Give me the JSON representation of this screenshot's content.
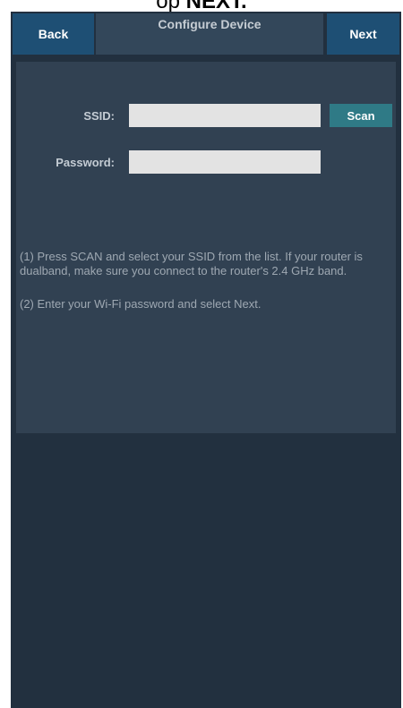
{
  "caption": {
    "prefix": "op ",
    "emphasis": "NEXT."
  },
  "header": {
    "back_label": "Back",
    "title": "Configure Device",
    "next_label": "Next"
  },
  "form": {
    "ssid_label": "SSID:",
    "ssid_value": "",
    "scan_label": "Scan",
    "password_label": "Password:",
    "password_value": ""
  },
  "instructions": {
    "step1": "(1) Press SCAN and select your SSID from the list. If your router is dualband, make sure you connect to the router's 2.4 GHz band.",
    "step2": "(2) Enter your Wi-Fi password and select Next."
  },
  "colors": {
    "background": "#22303f",
    "panel": "#314152",
    "nav_button": "#1e4f74",
    "scan_button": "#2f7a86",
    "field": "#e3e3e3"
  }
}
